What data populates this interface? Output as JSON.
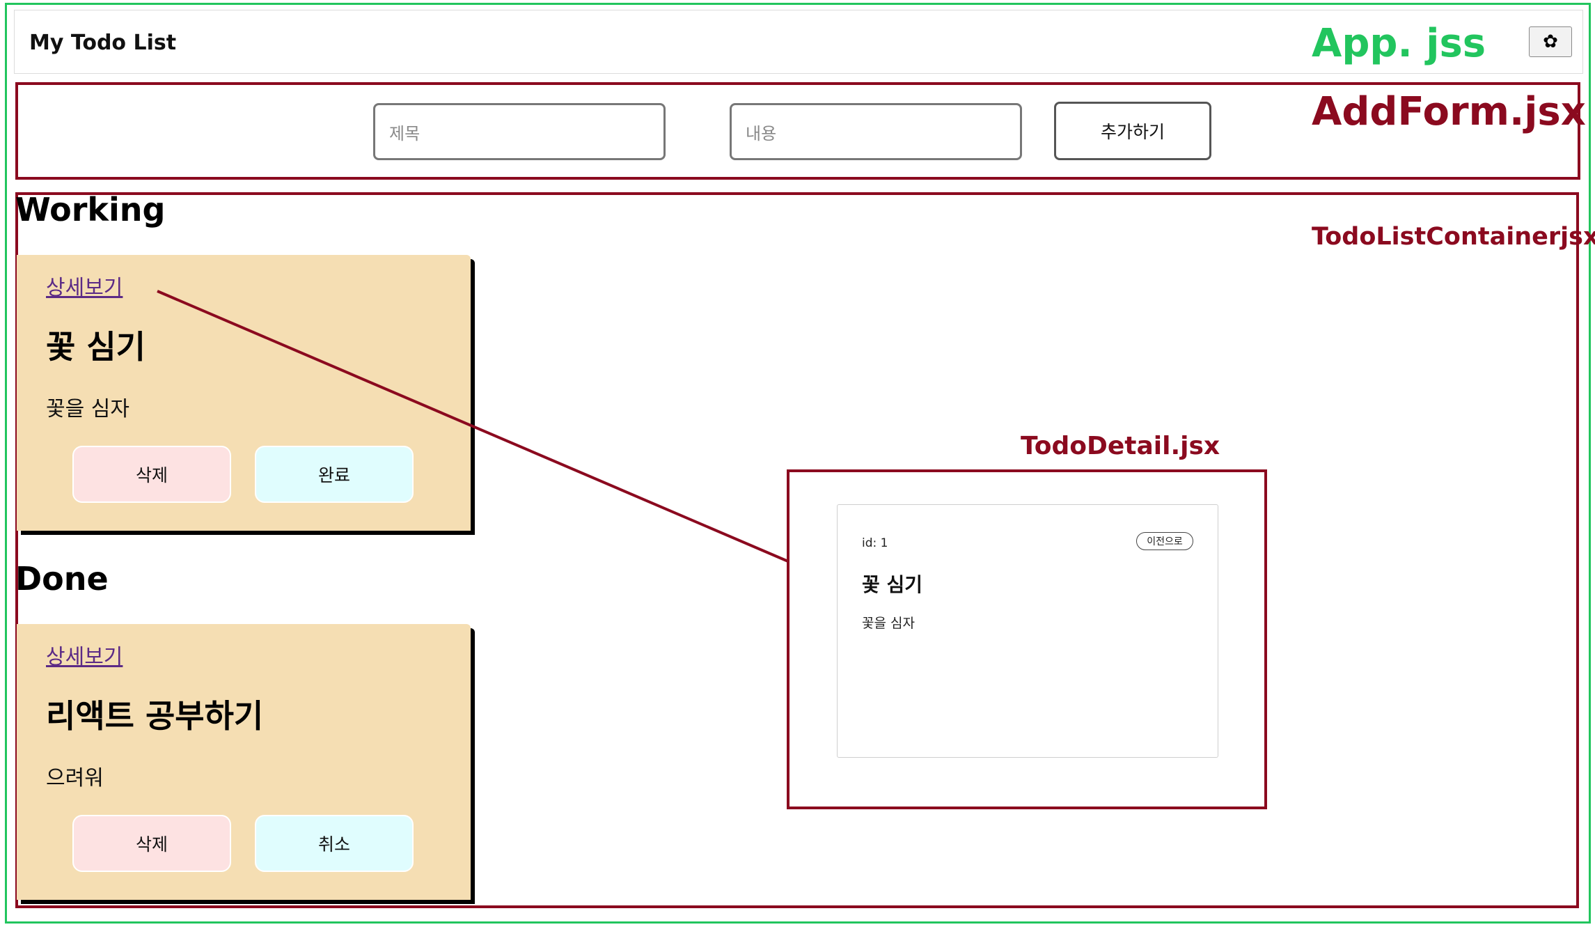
{
  "app": {
    "title": "My Todo List",
    "component_label": "App. jss",
    "header_button_icon": "flower-icon"
  },
  "addform": {
    "component_label": "AddForm.jsx",
    "title_placeholder": "제목",
    "content_placeholder": "내용",
    "add_button_label": "추가하기"
  },
  "container": {
    "component_label": "TodoListContainerjsx"
  },
  "working": {
    "section_title": "Working",
    "todo": {
      "detail_link": "상세보기",
      "title": "꽃 심기",
      "content": "꽃을 심자",
      "delete_label": "삭제",
      "toggle_label": "완료"
    }
  },
  "done": {
    "section_title": "Done",
    "todo": {
      "detail_link": "상세보기",
      "title": "리액트 공부하기",
      "content": "으려워",
      "delete_label": "삭제",
      "toggle_label": "취소"
    }
  },
  "detail": {
    "component_label": "TodoDetail.jsx",
    "id_text": "id: 1",
    "back_label": "이전으로",
    "title": "꽃 심기",
    "content": "꽃을 심자"
  },
  "colors": {
    "app_border": "#22c55e",
    "component_border": "#8b0a1f",
    "card_background": "#f5deb3",
    "delete_button": "#fde2e2",
    "toggle_button": "#e0fdfe"
  }
}
